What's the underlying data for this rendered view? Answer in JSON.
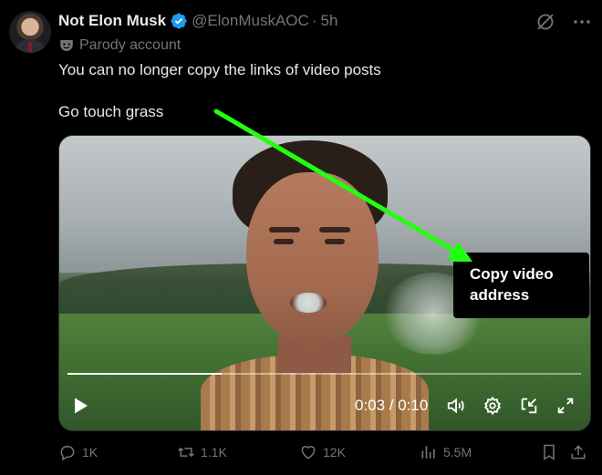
{
  "author": {
    "display_name": "Not Elon Musk",
    "handle": "@ElonMuskAOC",
    "separator": "·",
    "time": "5h",
    "parody_label": "Parody account"
  },
  "tweet": {
    "lines": [
      "You can no longer copy the links of video posts",
      "Go touch grass"
    ]
  },
  "video": {
    "current_time": "0:03",
    "duration": "0:10",
    "time_display": "0:03 / 0:10",
    "progress_fraction": 0.3
  },
  "context_menu": {
    "item": "Copy video address"
  },
  "annotation": {
    "arrow_color": "#22ff11"
  },
  "actions": {
    "replies": "1K",
    "reposts": "1.1K",
    "likes": "12K",
    "views": "5.5M"
  },
  "colors": {
    "background": "#000000",
    "text_primary": "#e7e9ea",
    "text_secondary": "#71767b",
    "verified": "#1d9bf0"
  },
  "icons": {
    "verified": "verified-badge-icon",
    "grok": "grok-icon",
    "more": "more-icon",
    "parody": "theater-mask-icon",
    "play": "play-icon",
    "volume": "volume-icon",
    "settings": "gear-icon",
    "pip": "picture-in-picture-icon",
    "fullscreen": "fullscreen-icon",
    "reply": "reply-icon",
    "repost": "repost-icon",
    "like": "heart-icon",
    "views": "views-icon",
    "bookmark": "bookmark-icon",
    "share": "share-icon"
  }
}
